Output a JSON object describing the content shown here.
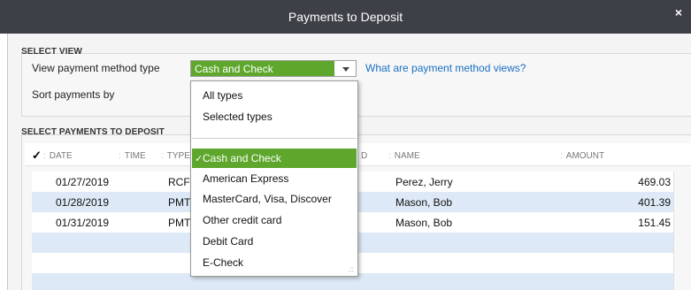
{
  "window": {
    "title": "Payments to Deposit",
    "close_glyph": "×"
  },
  "select_view": {
    "section_label": "SELECT VIEW",
    "method_label": "View payment method type",
    "method_value": "Cash and Check",
    "help_link": "What are payment method views?",
    "sort_label": "Sort payments by"
  },
  "dropdown": {
    "top_items": [
      "All types",
      "Selected types"
    ],
    "items": [
      {
        "label": "Cash and Check",
        "selected": true,
        "check": "✓"
      },
      {
        "label": "American Express"
      },
      {
        "label": "MasterCard, Visa, Discover"
      },
      {
        "label": "Other credit card"
      },
      {
        "label": "Debit Card"
      },
      {
        "label": "E-Check"
      }
    ],
    "resize_glyph": ".::"
  },
  "select_payments": {
    "section_label": "SELECT PAYMENTS TO DEPOSIT",
    "columns": {
      "check": "✓",
      "date": "DATE",
      "time": "TIME",
      "type": "TYPE",
      "d_hidden": "D",
      "name": "NAME",
      "amount": "AMOUNT",
      "sep": ":"
    },
    "rows": [
      {
        "date": "01/27/2019",
        "type": "RCF",
        "name": "Perez, Jerry",
        "amount": "469.03"
      },
      {
        "date": "01/28/2019",
        "type": "PMT",
        "name": "Mason, Bob",
        "amount": "401.39"
      },
      {
        "date": "01/31/2019",
        "type": "PMT",
        "name": "Mason, Bob",
        "amount": "151.45"
      }
    ]
  },
  "colors": {
    "titlebar": "#3d4046",
    "accent_green": "#5ea72c",
    "row_alt": "#dde9f6",
    "link": "#1a6fc2"
  }
}
